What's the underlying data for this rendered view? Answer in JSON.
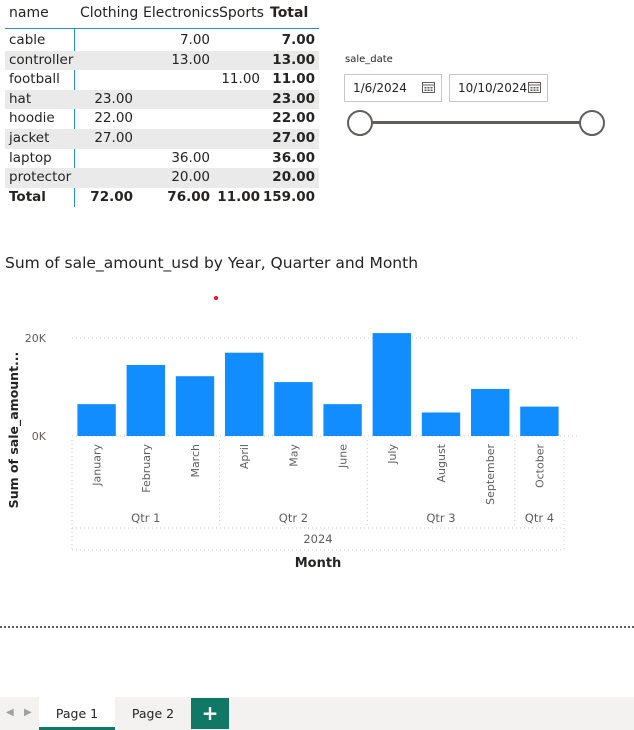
{
  "matrix": {
    "headers": {
      "name": "name",
      "clothing": "Clothing",
      "electronics": "Electronics",
      "sports": "Sports",
      "total": "Total"
    },
    "rows": [
      {
        "name": "cable",
        "clothing": "",
        "electronics": "7.00",
        "sports": "",
        "total": "7.00"
      },
      {
        "name": "controller",
        "clothing": "",
        "electronics": "13.00",
        "sports": "",
        "total": "13.00"
      },
      {
        "name": "football",
        "clothing": "",
        "electronics": "",
        "sports": "11.00",
        "total": "11.00"
      },
      {
        "name": "hat",
        "clothing": "23.00",
        "electronics": "",
        "sports": "",
        "total": "23.00"
      },
      {
        "name": "hoodie",
        "clothing": "22.00",
        "electronics": "",
        "sports": "",
        "total": "22.00"
      },
      {
        "name": "jacket",
        "clothing": "27.00",
        "electronics": "",
        "sports": "",
        "total": "27.00"
      },
      {
        "name": "laptop",
        "clothing": "",
        "electronics": "36.00",
        "sports": "",
        "total": "36.00"
      },
      {
        "name": "protector",
        "clothing": "",
        "electronics": "20.00",
        "sports": "",
        "total": "20.00"
      }
    ],
    "total_row": {
      "name": "Total",
      "clothing": "72.00",
      "electronics": "76.00",
      "sports": "11.00",
      "total": "159.00"
    }
  },
  "slicer": {
    "title": "sale_date",
    "start": "1/6/2024",
    "end": "10/10/2024",
    "range_fraction": [
      0,
      1
    ]
  },
  "chart_title": "Sum of sale_amount_usd by Year, Quarter and Month",
  "chart_data": {
    "type": "bar",
    "title": "Sum of sale_amount_usd by Year, Quarter and Month",
    "xlabel": "Month",
    "ylabel": "Sum of sale_amount...",
    "categories": [
      "January",
      "February",
      "March",
      "April",
      "May",
      "June",
      "July",
      "August",
      "September",
      "October"
    ],
    "values": [
      6500,
      14500,
      12200,
      17000,
      11000,
      6500,
      21000,
      4800,
      9600,
      6000
    ],
    "quarters": [
      {
        "label": "Qtr 1",
        "months": 3
      },
      {
        "label": "Qtr 2",
        "months": 3
      },
      {
        "label": "Qtr 3",
        "months": 3
      },
      {
        "label": "Qtr 4",
        "months": 1
      }
    ],
    "year": "2024",
    "yticks": [
      0,
      20000
    ],
    "ytick_labels": [
      "0K",
      "20K"
    ],
    "ylim": [
      0,
      22000
    ],
    "grid": true,
    "color": "#118dff"
  },
  "tabs": {
    "pages": [
      "Page 1",
      "Page 2"
    ],
    "active": 0,
    "add_label": "+",
    "prev_icon": "chevron-left-icon",
    "next_icon": "chevron-right-icon"
  }
}
